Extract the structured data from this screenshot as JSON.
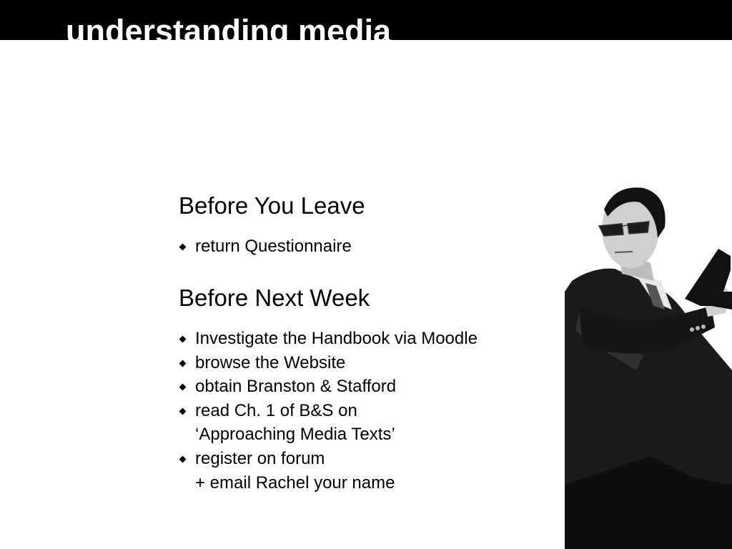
{
  "header": {
    "title": "understanding media"
  },
  "sections": [
    {
      "heading": "Before You Leave",
      "items": [
        {
          "lines": [
            "return Questionnaire"
          ]
        }
      ]
    },
    {
      "heading": "Before Next Week",
      "items": [
        {
          "lines": [
            "Investigate the Handbook via Moodle"
          ]
        },
        {
          "lines": [
            "browse the Website"
          ]
        },
        {
          "lines": [
            "obtain Branston & Stafford"
          ]
        },
        {
          "lines": [
            "read Ch. 1 of B&S on",
            "‘Approaching Media Texts’"
          ]
        },
        {
          "lines": [
            "register on forum",
            "+ email Rachel your name"
          ]
        }
      ]
    }
  ],
  "image": {
    "description": "black-and-white photo of man in suit and sunglasses holding a pistol"
  },
  "colors": {
    "header_bg": "#000000",
    "header_text": "#ffffff",
    "body_text": "#000000"
  }
}
